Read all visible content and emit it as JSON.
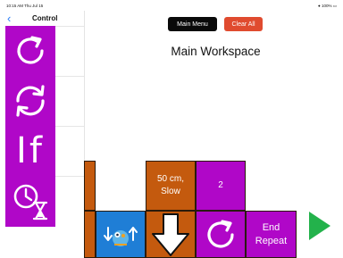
{
  "status_bar": {
    "time_date": "10:15 AM   Thu Jul 15",
    "battery": "● 100% ▭"
  },
  "sidebar": {
    "back_icon": "chevron-left-icon",
    "title": "Control",
    "palette": [
      {
        "name": "repeat",
        "icon": "repeat-arrow-icon"
      },
      {
        "name": "repeat-forever",
        "icon": "cycle-arrows-icon"
      },
      {
        "name": "if",
        "label": "If"
      },
      {
        "name": "wait",
        "icon": "clock-hourglass-icon"
      }
    ]
  },
  "workspace": {
    "buttons": {
      "main_menu": "Main Menu",
      "clear_all": "Clear All"
    },
    "title": "Main Workspace",
    "blocks": [
      {
        "type": "parameter",
        "label": "50 cm,\nSlow",
        "color": "#c45a0e"
      },
      {
        "type": "parameter",
        "label": "2",
        "color": "#b007c8"
      },
      {
        "type": "start",
        "icon": "robot-sensor-icon",
        "color": "#1f7ed6"
      },
      {
        "type": "move",
        "icon": "down-arrow-icon",
        "color": "#c45a0e"
      },
      {
        "type": "repeat",
        "icon": "repeat-arrow-icon",
        "color": "#b007c8"
      },
      {
        "type": "end-repeat",
        "label": "End\nRepeat",
        "color": "#b007c8"
      }
    ],
    "play_icon": "play-icon"
  },
  "colors": {
    "control": "#b007c8",
    "move": "#c45a0e",
    "start": "#1f7ed6",
    "play": "#23b24b",
    "clear": "#e04b2f"
  }
}
